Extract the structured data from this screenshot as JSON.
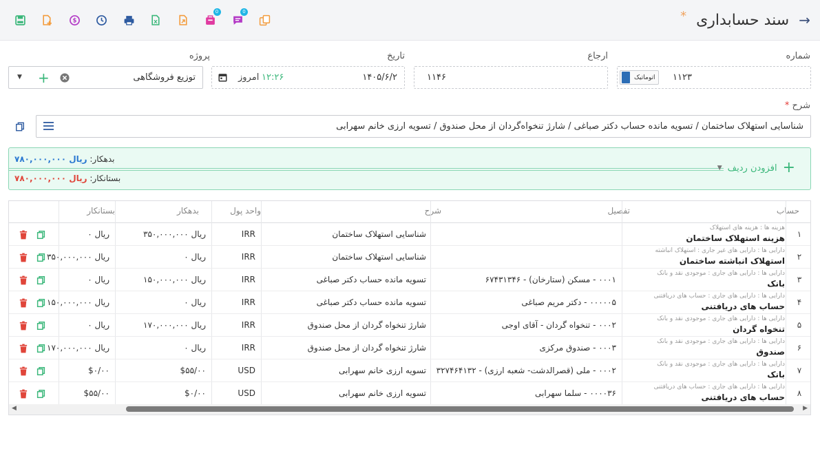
{
  "header": {
    "title": "سند حسابداری",
    "star": "*",
    "back_icon": "arrow-right-icon",
    "toolbar": [
      {
        "name": "save-icon",
        "color": "#3ab77a"
      },
      {
        "name": "add-document-icon",
        "color": "#f39c3d"
      },
      {
        "name": "dollar-icon",
        "color": "#b33ac6"
      },
      {
        "name": "clock-icon",
        "color": "#2d5aa0"
      },
      {
        "name": "print-icon",
        "color": "#2d5aa0"
      },
      {
        "name": "excel-icon",
        "color": "#3ab77a"
      },
      {
        "name": "export-icon",
        "color": "#f39c3d"
      },
      {
        "name": "attachment-icon",
        "color": "#e03aa0",
        "badge": "0"
      },
      {
        "name": "comment-icon",
        "color": "#b33ac6",
        "badge": "0"
      },
      {
        "name": "copy-documents-icon",
        "color": "#f39c3d"
      }
    ]
  },
  "form": {
    "number_label": "شماره",
    "number_value": "۱۱۲۳",
    "auto_label": "اتوماتیک",
    "reference_label": "ارجاع",
    "reference_value": "۱۱۴۶",
    "date_label": "تاریخ",
    "date_value": "۱۴۰۵/۶/۲",
    "time_value": "۱۲:۲۶",
    "today_label": "امروز",
    "project_label": "پروژه",
    "project_value": "توزیع فروشگاهی",
    "description_label": "شرح",
    "description_required": "*",
    "description_value": "شناسایی استهلاک ساختمان / تسویه مانده حساب دکتر صباغی / شارژ تنخواه‌گردان از محل صندوق / تسویه ارزی خانم سهرابی"
  },
  "summary": {
    "debit_label": "بدهکار:",
    "debit_value": "ریال ۷۸۰,۰۰۰,۰۰۰",
    "credit_label": "بستانکار:",
    "credit_value": "ریال ۷۸۰,۰۰۰,۰۰۰",
    "add_row_label": "افزودن ردیف"
  },
  "table": {
    "headers": {
      "account": "حساب",
      "detail": "تفصیل",
      "description": "شرح",
      "currency": "واحد پول",
      "debit": "بدهکار",
      "credit": "بستانکار"
    },
    "rows": [
      {
        "num": "۱",
        "path": "هزینه ها : هزینه های استهلاک",
        "account": "هزینه استهلاک ساختمان",
        "detail": "",
        "desc": "شناسایی استهلاک ساختمان",
        "currency": "IRR",
        "debit": "ریال ۳۵۰,۰۰۰,۰۰۰",
        "credit": "ریال ۰"
      },
      {
        "num": "۲",
        "path": "دارایی ها : دارایی های غیر جاری : استهلاک انباشته",
        "account": "استهلاک انباشته ساختمان",
        "detail": "",
        "desc": "شناسایی استهلاک ساختمان",
        "currency": "IRR",
        "debit": "ریال ۰",
        "credit": "ریال ۳۵۰,۰۰۰,۰۰۰"
      },
      {
        "num": "۳",
        "path": "دارایی ها : دارایی های جاری : موجودی نقد و بانک",
        "account": "بانک",
        "detail": "۰۰۰۱ - مسکن (ستارخان) - ۶۷۴۳۱۳۴۶",
        "desc": "تسویه مانده حساب دکتر صباغی",
        "currency": "IRR",
        "debit": "ریال ۱۵۰,۰۰۰,۰۰۰",
        "credit": "ریال ۰"
      },
      {
        "num": "۴",
        "path": "دارایی ها : دارایی های جاری : حساب های دریافتنی",
        "account": "حساب های دریافتنی",
        "detail": "۰۰۰۰۰۵ - دکتر مریم صباغی",
        "desc": "تسویه مانده حساب دکتر صباغی",
        "currency": "IRR",
        "debit": "ریال ۰",
        "credit": "ریال ۱۵۰,۰۰۰,۰۰۰"
      },
      {
        "num": "۵",
        "path": "دارایی ها : دارایی های جاری : موجودی نقد و بانک",
        "account": "تنخواه گردان",
        "detail": "۰۰۰۲ - تنخواه گردان - آقای اوجی",
        "desc": "شارژ تنخواه گردان از محل صندوق",
        "currency": "IRR",
        "debit": "ریال ۱۷۰,۰۰۰,۰۰۰",
        "credit": "ریال ۰"
      },
      {
        "num": "۶",
        "path": "دارایی ها : دارایی های جاری : موجودی نقد و بانک",
        "account": "صندوق",
        "detail": "۰۰۰۳ - صندوق مرکزی",
        "desc": "شارژ تنخواه گردان از محل صندوق",
        "currency": "IRR",
        "debit": "ریال ۰",
        "credit": "ریال ۱۷۰,۰۰۰,۰۰۰"
      },
      {
        "num": "۷",
        "path": "دارایی ها : دارایی های جاری : موجودی نقد و بانک",
        "account": "بانک",
        "detail": "۰۰۰۲ - ملی (قصرالدشت- شعبه ارزی) - ۳۲۷۴۶۴۱۳۲",
        "desc": "تسویه ارزی خانم سهرابی",
        "currency": "USD",
        "debit": "$۵۵/۰۰",
        "credit": "$۰/۰۰"
      },
      {
        "num": "۸",
        "path": "دارایی ها : دارایی های جاری : حساب های دریافتنی",
        "account": "حساب های دریافتنی",
        "detail": "۰۰۰۰۳۶ - سلما سهرابی",
        "desc": "تسویه ارزی خانم سهرابی",
        "currency": "USD",
        "debit": "$۰/۰۰",
        "credit": "$۵۵/۰۰"
      }
    ]
  }
}
